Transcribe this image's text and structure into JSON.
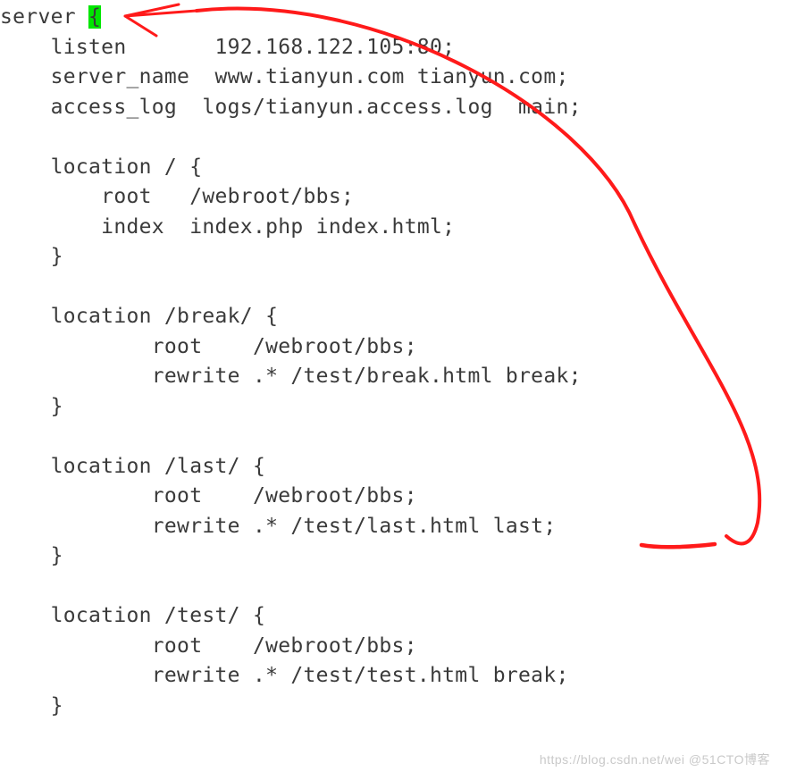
{
  "code": {
    "l0_a": "server ",
    "l0_b": "{",
    "l1": "    listen       192.168.122.105:80;",
    "l2": "    server_name  www.tianyun.com tianyun.com;",
    "l3": "    access_log  logs/tianyun.access.log  main;",
    "l4": "",
    "l5": "    location / {",
    "l6": "        root   /webroot/bbs;",
    "l7": "        index  index.php index.html;",
    "l8": "    }",
    "l9": "",
    "l10": "    location /break/ {",
    "l11": "            root    /webroot/bbs;",
    "l12": "            rewrite .* /test/break.html break;",
    "l13": "    }",
    "l14": "",
    "l15": "    location /last/ {",
    "l16": "            root    /webroot/bbs;",
    "l17": "            rewrite .* /test/last.html last;",
    "l18": "    }",
    "l19": "",
    "l20": "    location /test/ {",
    "l21": "            root    /webroot/bbs;",
    "l22": "            rewrite .* /test/test.html break;",
    "l23": "    }"
  },
  "annotation": {
    "underlined_word": "last",
    "arrow_target_line": 0,
    "arrow_source_line": 17
  },
  "watermark": "https://blog.csdn.net/wei @51CTO博客"
}
